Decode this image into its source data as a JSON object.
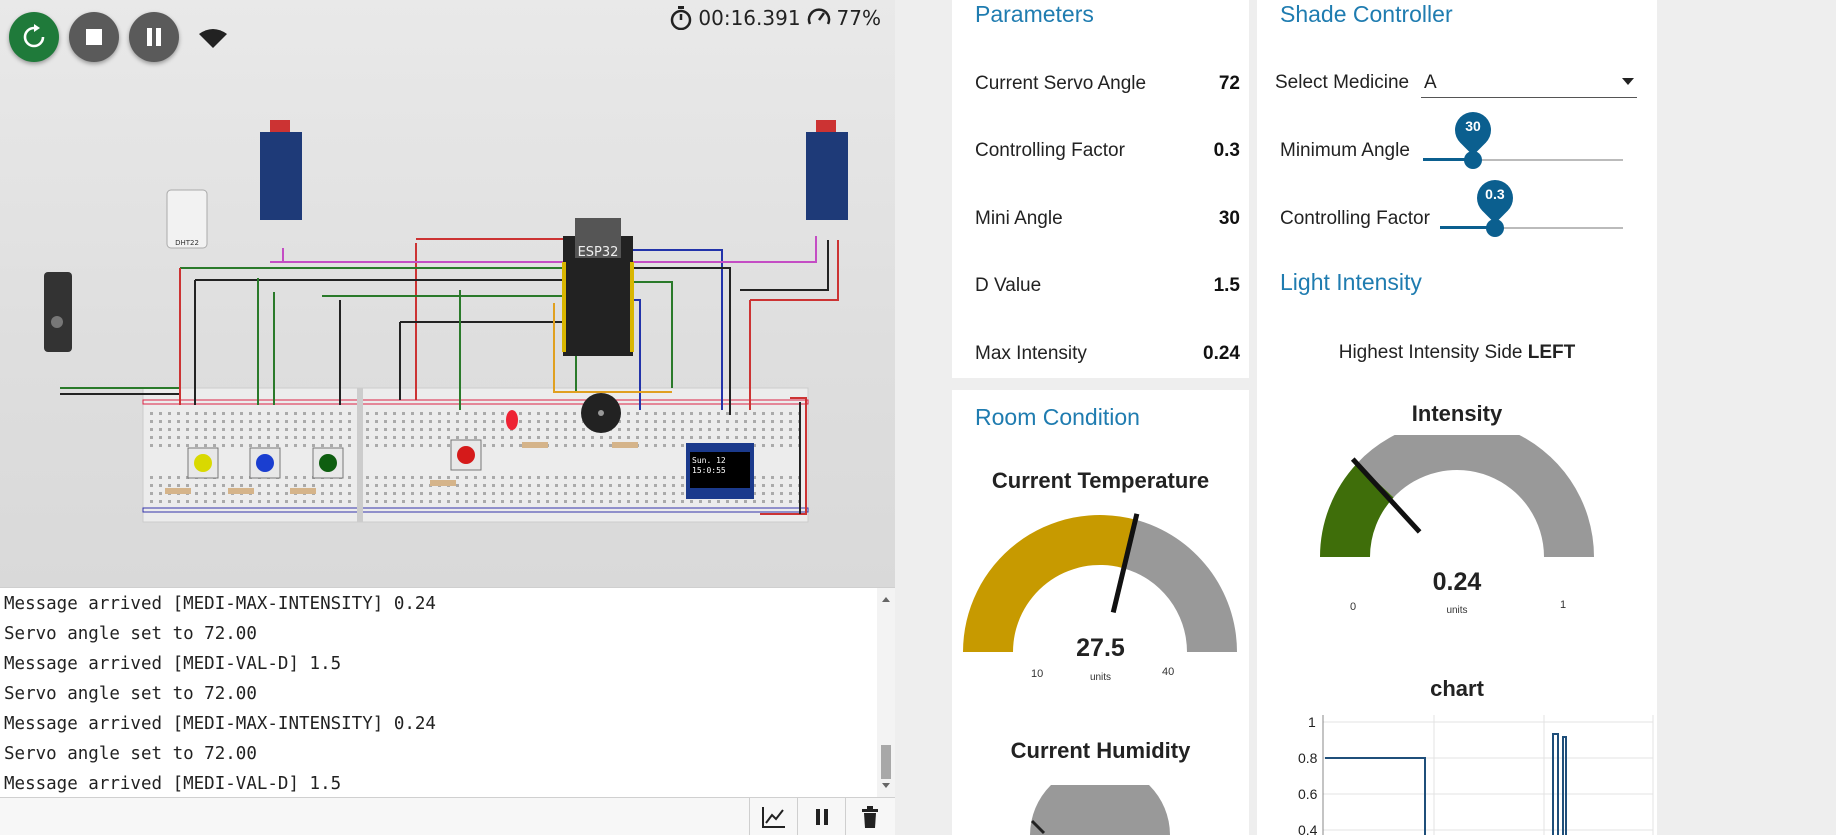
{
  "simulator": {
    "timer": "00:16.391",
    "speed": "77%",
    "board_label": "ESP32",
    "sensor_label": "DHT22",
    "oled_text_line1": "Sun. 12",
    "oled_text_line2": "15:0:55"
  },
  "serial_monitor": {
    "lines": [
      "Message arrived [MEDI-MAX-INTENSITY] 0.24",
      "Servo angle set to 72.00",
      "Message arrived [MEDI-VAL-D] 1.5",
      "Servo angle set to 72.00",
      "Message arrived [MEDI-MAX-INTENSITY] 0.24",
      "Servo angle set to 72.00",
      "Message arrived [MEDI-VAL-D] 1.5"
    ]
  },
  "parameters": {
    "title": "Parameters",
    "rows": [
      {
        "label": "Current Servo Angle",
        "value": "72"
      },
      {
        "label": "Controlling Factor",
        "value": "0.3"
      },
      {
        "label": "Mini Angle",
        "value": "30"
      },
      {
        "label": "D Value",
        "value": "1.5"
      },
      {
        "label": "Max Intensity",
        "value": "0.24"
      }
    ]
  },
  "shade_controller": {
    "title": "Shade Controller",
    "select_label": "Select Medicine",
    "select_value": "A",
    "min_angle_label": "Minimum Angle",
    "min_angle_value": "30",
    "min_angle_fraction": 0.25,
    "factor_label": "Controlling Factor",
    "factor_value": "0.3",
    "factor_fraction": 0.3
  },
  "light_intensity": {
    "title": "Light Intensity",
    "highest_label": "Highest Intensity Side",
    "highest_value": "LEFT",
    "gauge": {
      "title": "Intensity",
      "value": "0.24",
      "units": "units",
      "min": "0",
      "max": "1",
      "fraction": 0.24,
      "color": "#3f6e0a"
    }
  },
  "room_condition": {
    "title": "Room Condition",
    "temperature": {
      "title": "Current Temperature",
      "value": "27.5",
      "units": "units",
      "min": "10",
      "max": "40",
      "fraction": 0.583,
      "color": "#c79a00"
    },
    "humidity": {
      "title": "Current Humidity"
    }
  },
  "chart": {
    "title": "chart",
    "y_ticks": [
      "1",
      "0.8",
      "0.6",
      "0.4"
    ]
  },
  "colors": {
    "accent": "#1f7cb0",
    "slider": "#0b5f8f",
    "gauge_bg": "#999999",
    "restart": "#1f7a3a"
  }
}
